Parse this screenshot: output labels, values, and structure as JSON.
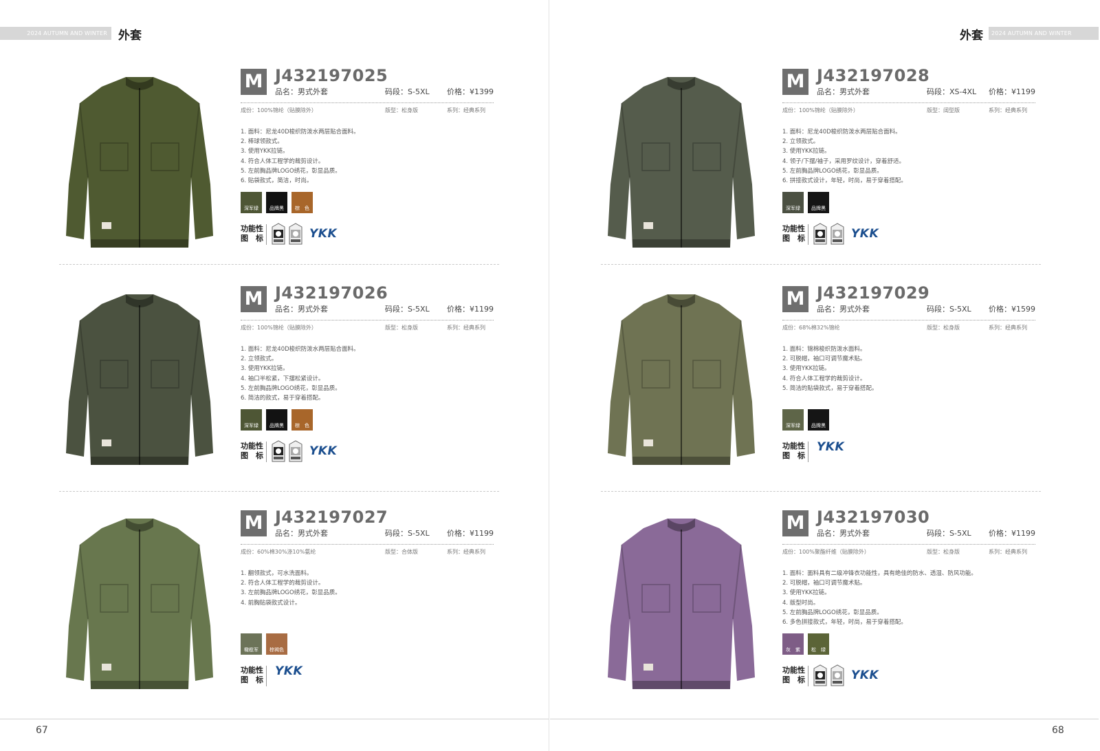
{
  "header": {
    "season": "2024 AUTUMN AND WINTER",
    "category": "外套"
  },
  "footer": {
    "left_page": "67",
    "right_page": "68"
  },
  "label_func": [
    "功能性",
    "图　标"
  ],
  "products": [
    {
      "badge": "M",
      "code": "J432197025",
      "name": "品名：男式外套",
      "size": "码段：S-5XL",
      "price": "价格：¥1399",
      "composition": "成份：100%锦纶（贴膜除外）",
      "fit": "版型：松身版",
      "series": "系列：经典系列",
      "features": [
        "1. 面料：尼龙40D梭织防泼水两层贴合面料。",
        "2. 棒球领款式。",
        "3. 使用YKK拉链。",
        "4. 符合人体工程学的裁剪设计。",
        "5. 左前胸品牌LOGO绣花，彰显品质。",
        "6. 贴袋款式，简洁，时尚。"
      ],
      "colors": [
        {
          "name": "深军绿",
          "hex": "#4e5635"
        },
        {
          "name": "品牌黑",
          "hex": "#121212"
        },
        {
          "name": "棕　色",
          "hex": "#a8662a"
        }
      ],
      "jacket_color": "#4f5a31",
      "func_icons": [
        "waterproof-label-icon",
        "warm-label-icon"
      ],
      "ykk": "YKK"
    },
    {
      "badge": "M",
      "code": "J432197026",
      "name": "品名：男式外套",
      "size": "码段：S-5XL",
      "price": "价格：¥1199",
      "composition": "成份：100%锦纶（贴膜除外）",
      "fit": "版型：松身版",
      "series": "系列：经典系列",
      "features": [
        "1. 面料：尼龙40D梭织防泼水两层贴合面料。",
        "2. 立领款式。",
        "3. 使用YKK拉链。",
        "4. 袖口半松紧，下摆松紧设计。",
        "5. 左前胸品牌LOGO绣花，彰显品质。",
        "6. 简洁的款式，易于穿着搭配。"
      ],
      "colors": [
        {
          "name": "深军绿",
          "hex": "#4e5635"
        },
        {
          "name": "品牌黑",
          "hex": "#121212"
        },
        {
          "name": "棕　色",
          "hex": "#a8662a"
        }
      ],
      "jacket_color": "#4b5240",
      "func_icons": [
        "waterproof-label-icon",
        "warm-label-icon"
      ],
      "ykk": "YKK"
    },
    {
      "badge": "M",
      "code": "J432197027",
      "name": "品名：男式外套",
      "size": "码段：S-5XL",
      "price": "价格：¥1199",
      "composition": "成份：60%棉30%涤10%氨纶",
      "fit": "版型：合体版",
      "series": "系列：经典系列",
      "features": [
        "1. 翻领款式，可水洗面料。",
        "2. 符合人体工程学的裁剪设计。",
        "3. 左前胸品牌LOGO绣花，彰显品质。",
        "4. 前胸贴袋款式设计。"
      ],
      "colors": [
        {
          "name": "橄榄军",
          "hex": "#6c7358"
        },
        {
          "name": "棕褐色",
          "hex": "#a86c43"
        }
      ],
      "jacket_color": "#68774e",
      "func_icons": [],
      "ykk": "YKK"
    },
    {
      "badge": "M",
      "code": "J432197028",
      "name": "品名：男式外套",
      "size": "码段：XS-4XL",
      "price": "价格：¥1199",
      "composition": "成份：100%锦纶（贴膜除外）",
      "fit": "版型：阔型版",
      "series": "系列：经典系列",
      "features": [
        "1. 面料：尼龙40D梭织防泼水两层贴合面料。",
        "2. 立领款式。",
        "3. 使用YKK拉链。",
        "4. 领子/下摆/袖子，采用罗纹设计，穿着舒适。",
        "5. 左前胸品牌LOGO绣花，彰显品质。",
        "6. 拼接款式设计，年轻，时尚，易于穿着搭配。"
      ],
      "colors": [
        {
          "name": "深军绿",
          "hex": "#4b5042"
        },
        {
          "name": "品牌黑",
          "hex": "#151515"
        }
      ],
      "jacket_color": "#555c4c",
      "func_icons": [
        "waterproof-label-icon",
        "warm-label-icon"
      ],
      "ykk": "YKK"
    },
    {
      "badge": "M",
      "code": "J432197029",
      "name": "品名：男式外套",
      "size": "码段：S-5XL",
      "price": "价格：¥1599",
      "composition": "成份：68%棉32%锦纶",
      "fit": "版型：松身版",
      "series": "系列：经典系列",
      "features": [
        "1. 面料：锦棉梭织防泼水面料。",
        "2. 可脱帽，袖口可调节魔术贴。",
        "3. 使用YKK拉链。",
        "4. 符合人体工程学的裁剪设计。",
        "5. 简洁的贴袋款式，易于穿着搭配。"
      ],
      "colors": [
        {
          "name": "深军绿",
          "hex": "#5e6548"
        },
        {
          "name": "品牌黑",
          "hex": "#151515"
        }
      ],
      "jacket_color": "#6f7353",
      "func_icons": [],
      "ykk": "YKK"
    },
    {
      "badge": "M",
      "code": "J432197030",
      "name": "品名：男式外套",
      "size": "码段：S-5XL",
      "price": "价格：¥1199",
      "composition": "成份：100%聚酯纤维（贴膜除外）",
      "fit": "版型：松身版",
      "series": "系列：经典系列",
      "features": [
        "1. 面料：面料具有二级冲锋衣功能性，具有绝佳的防水、透湿、防风功能。",
        "2. 可脱帽，袖口可调节魔术贴。",
        "3. 使用YKK拉链。",
        "4. 版型时尚。",
        "5. 左前胸品牌LOGO绣花，彰显品质。",
        "6. 多色拼接款式，年轻，时尚，易于穿着搭配。"
      ],
      "colors": [
        {
          "name": "灰　紫",
          "hex": "#7e5d86"
        },
        {
          "name": "松　绿",
          "hex": "#5b6437"
        }
      ],
      "jacket_color": "#8a6a98",
      "func_icons": [
        "waterproof-label-icon",
        "warm-label-icon"
      ],
      "ykk": "YKK"
    }
  ]
}
